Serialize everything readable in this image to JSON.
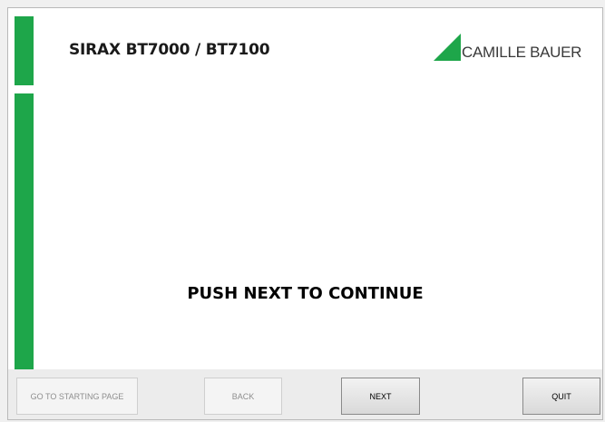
{
  "header": {
    "title": "SIRAX BT7000 / BT7100",
    "logo_text": "CAMILLE BAUER",
    "logo_icon": "green-triangle-icon"
  },
  "main": {
    "message": "PUSH NEXT TO CONTINUE"
  },
  "footer": {
    "start_label": "GO TO STARTING PAGE",
    "back_label": "BACK",
    "next_label": "NEXT",
    "quit_label": "QUIT"
  },
  "colors": {
    "accent_green": "#1ea64a",
    "background": "#ececec"
  }
}
